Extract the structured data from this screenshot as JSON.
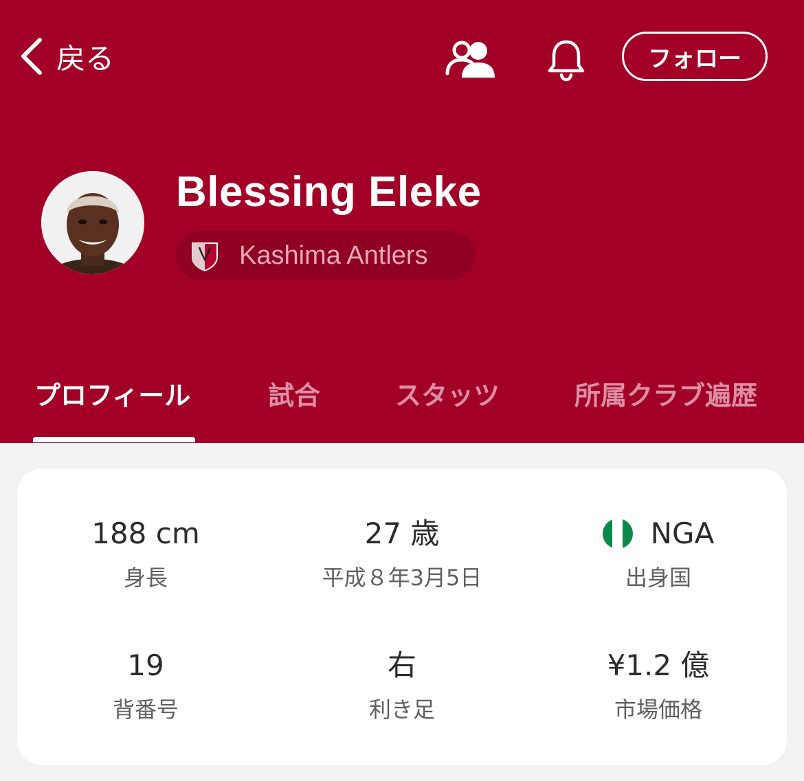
{
  "nav": {
    "back_label": "戻る",
    "follow_label": "フォロー",
    "people_icon": "people-icon",
    "bell_icon": "bell-icon"
  },
  "player": {
    "name": "Blessing Eleke",
    "club": "Kashima Antlers"
  },
  "tabs": [
    {
      "label": "プロフィール",
      "active": true
    },
    {
      "label": "試合",
      "active": false
    },
    {
      "label": "スタッツ",
      "active": false
    },
    {
      "label": "所属クラブ遍歴",
      "active": false
    }
  ],
  "profile": {
    "height": {
      "value": "188 cm",
      "label": "身長"
    },
    "age": {
      "value": "27 歳",
      "label": "平成８年3月5日"
    },
    "nationality": {
      "value": "NGA",
      "label": "出身国"
    },
    "number": {
      "value": "19",
      "label": "背番号"
    },
    "foot": {
      "value": "右",
      "label": "利き足"
    },
    "market_value": {
      "value": "¥1.2 億",
      "label": "市場価格"
    }
  },
  "colors": {
    "header_bg": "#a30027",
    "tab_inactive": "#dc8fa3",
    "flag_green": "#0a8a4a"
  }
}
